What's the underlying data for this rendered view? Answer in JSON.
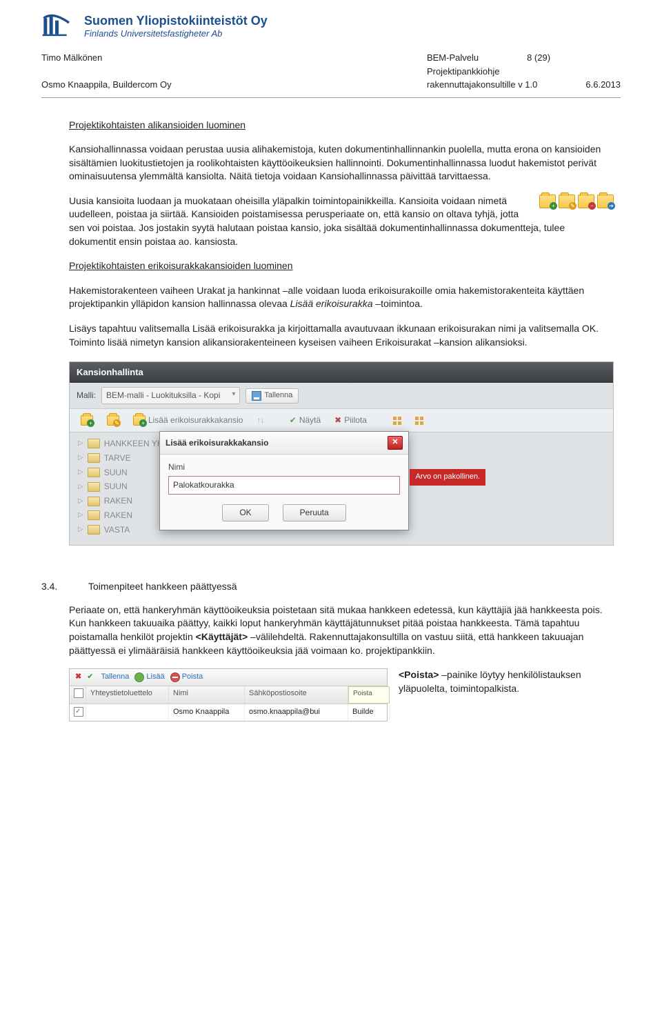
{
  "logo": {
    "fi": "Suomen Yliopistokiinteistöt Oy",
    "sv": "Finlands Universitetsfastigheter Ab"
  },
  "header": {
    "left_line1": "Timo Mälkönen",
    "left_line2": "Osmo Knaappila, Buildercom Oy",
    "right_line1": "BEM-Palvelu",
    "right_line2": "Projektipankkiohje",
    "right_line3": "rakennuttajakonsultille v 1.0",
    "page": "8 (29)",
    "date": "6.6.2013"
  },
  "content": {
    "h1": "Projektikohtaisten alikansioiden luominen",
    "p1": "Kansiohallinnassa voidaan perustaa uusia alihakemistoja, kuten dokumentinhallinnankin puolella, mutta erona on kansioiden sisältämien luokitustietojen ja roolikohtaisten käyttöoikeuksien hallinnointi. Dokumentinhallinnassa luodut hakemistot perivät ominaisuutensa ylemmältä kansiolta. Näitä tietoja voidaan Kansiohallinnassa päivittää tarvittaessa.",
    "p2": "Uusia kansioita luodaan ja muokataan oheisilla yläpalkin toimintopainikkeilla. Kansioita voidaan nimetä uudelleen, poistaa ja siirtää. Kansioiden poistamisessa perusperiaate on, että kansio on oltava tyhjä, jotta sen voi poistaa. Jos jostakin syytä halutaan poistaa kansio, joka sisältää dokumentinhallinnassa dokumentteja, tulee dokumentit ensin poistaa ao. kansiosta.",
    "h2": "Projektikohtaisten erikoisurakkakansioiden luominen",
    "p3a": "Hakemistorakenteen vaiheen Urakat ja hankinnat –alle voidaan luoda erikoisurakoille omia hakemistorakenteita käyttäen projektipankin ylläpidon kansion hallinnassa olevaa ",
    "p3i": "Lisää erikoisurakka",
    "p3b": " –toimintoa.",
    "p4": "Lisäys tapahtuu valitsemalla Lisää erikoisurakka ja kirjoittamalla avautuvaan ikkunaan erikoisurakan nimi ja valitsemalla OK. Toiminto lisää nimetyn kansion alikansiorakenteineen kyseisen vaiheen Erikoisurakat –kansion alikansioksi."
  },
  "screenshot1": {
    "title": "Kansionhallinta",
    "malli_label": "Malli:",
    "malli_value": "BEM-malli - Luokituksilla - Kopi",
    "tallenna": "Tallenna",
    "tb_add": "Lisää erikoisurakkakansio",
    "tb_nayta": "Näytä",
    "tb_piilota": "Piilota",
    "tree": [
      "HANKKEEN YHTEISET TIEDOT",
      "TARVE",
      "SUUN",
      "SUUN",
      "RAKEN",
      "RAKEN",
      "VASTA"
    ],
    "dialog": {
      "title": "Lisää erikoisurakkakansio",
      "label": "Nimi",
      "value": "Palokatkourakka",
      "ok": "OK",
      "cancel": "Peruuta",
      "required": "Arvo on pakollinen."
    }
  },
  "section34": {
    "num": "3.4.",
    "title": "Toimenpiteet hankkeen päättyessä",
    "p1a": "Periaate on, että hankeryhmän käyttöoikeuksia poistetaan sitä mukaa hankkeen edetessä, kun käyttäjiä jää hankkeesta pois. Kun hankkeen takuuaika päättyy, kaikki loput hankeryhmän käyttäjätunnukset pitää poistaa hankkeesta. Tämä tapahtuu poistamalla henkilöt projektin ",
    "p1b1": "<Käyttäjät>",
    "p1c": " –välilehdeltä. Rakennuttajakonsultilla on vastuu siitä, että hankkeen takuuajan päättyessä ei ylimääräisiä hankkeen käyttöoikeuksia jää voimaan ko. projektipankkiin.",
    "note_a": "<Poista>",
    "note_b": " –painike löytyy henkilölistauksen yläpuolelta, toimintopalkista."
  },
  "screenshot2": {
    "tallenna": "Tallenna",
    "lisaa": "Lisää",
    "poista": "Poista",
    "col_check": "",
    "col1": "Yhteystietoluettelo",
    "col2": "Nimi",
    "col3": "Sähköpostiosoite",
    "col4_hover": "Poista",
    "row_name": "Osmo Knaappila",
    "row_email": "osmo.knaappila@bui",
    "row_co": "Builde"
  }
}
